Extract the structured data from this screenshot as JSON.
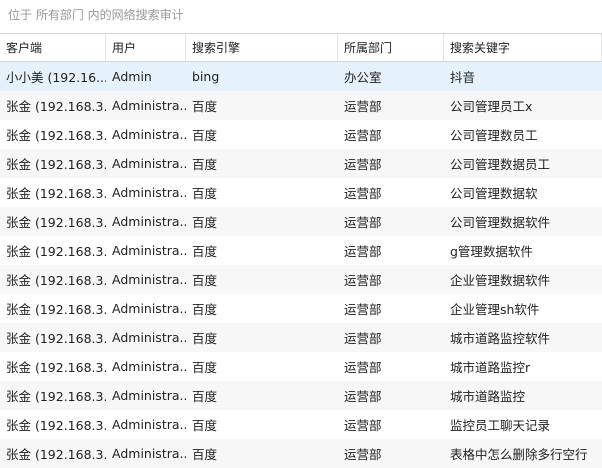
{
  "location": "位于 所有部门 内的网络搜索审计",
  "columns": [
    "客户端",
    "用户",
    "搜索引擎",
    "所属部门",
    "搜索关键字"
  ],
  "rows": [
    [
      "小小美 (192.16...",
      "Admin",
      "bing",
      "办公室",
      "抖音"
    ],
    [
      "张金 (192.168.3...",
      "Administra...",
      "百度",
      "运营部",
      "公司管理员工x"
    ],
    [
      "张金 (192.168.3...",
      "Administra...",
      "百度",
      "运营部",
      "公司管理数员工"
    ],
    [
      "张金 (192.168.3...",
      "Administra...",
      "百度",
      "运营部",
      "公司管理数据员工"
    ],
    [
      "张金 (192.168.3...",
      "Administra...",
      "百度",
      "运营部",
      "公司管理数据软"
    ],
    [
      "张金 (192.168.3...",
      "Administra...",
      "百度",
      "运营部",
      "公司管理数据软件"
    ],
    [
      "张金 (192.168.3...",
      "Administra...",
      "百度",
      "运营部",
      "g管理数据软件"
    ],
    [
      "张金 (192.168.3...",
      "Administra...",
      "百度",
      "运营部",
      "企业管理数据软件"
    ],
    [
      "张金 (192.168.3...",
      "Administra...",
      "百度",
      "运营部",
      "企业管理sh软件"
    ],
    [
      "张金 (192.168.3...",
      "Administra...",
      "百度",
      "运营部",
      "城市道路监控软件"
    ],
    [
      "张金 (192.168.3...",
      "Administra...",
      "百度",
      "运营部",
      "城市道路监控r"
    ],
    [
      "张金 (192.168.3...",
      "Administra...",
      "百度",
      "运营部",
      "城市道路监控"
    ],
    [
      "张金 (192.168.3...",
      "Administra...",
      "百度",
      "运营部",
      "监控员工聊天记录"
    ],
    [
      "张金 (192.168.3...",
      "Administra...",
      "百度",
      "运营部",
      "表格中怎么删除多行空行"
    ]
  ],
  "selected_row": 0,
  "colors": {
    "selected_bg": "#e5f1fb",
    "alt_bg": "#f7f7f7",
    "header_border": "#d6d6d6"
  }
}
